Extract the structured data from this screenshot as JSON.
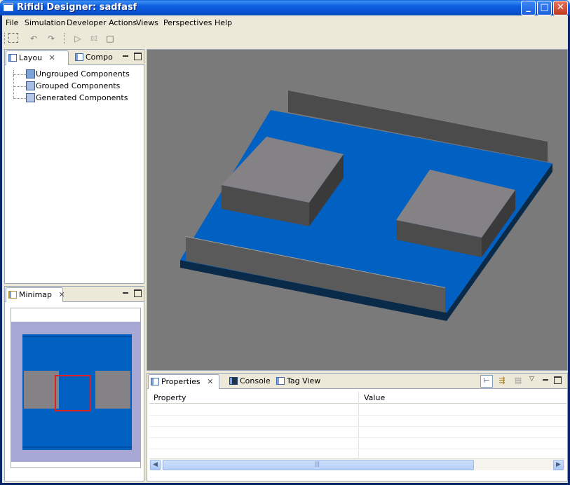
{
  "window": {
    "title": "Rifidi Designer: sadfasf",
    "min_icon": "minimize-icon",
    "max_icon": "maximize-icon",
    "close_icon": "close-icon"
  },
  "menu": [
    "File",
    "Simulation",
    "Developer Actions",
    "Views",
    "Perspectives",
    "Help"
  ],
  "toolbar": {
    "icons": [
      "grid-icon",
      "rotate-left-icon",
      "rotate-right-icon",
      "play-icon",
      "pause-icon",
      "stop-icon"
    ],
    "play_glyph": "▷",
    "pause_glyph": "▯▯",
    "stop_glyph": "□"
  },
  "layout_panel": {
    "tabs": [
      {
        "label": "Layou",
        "close": "✕"
      },
      {
        "label": "Compo"
      }
    ],
    "tree": [
      "Ungrouped Components",
      "Grouped Components",
      "Generated Components"
    ]
  },
  "minimap_panel": {
    "tab_label": "Minimap",
    "close": "✕"
  },
  "properties_panel": {
    "tabs": [
      {
        "label": "Properties",
        "close": "✕"
      },
      {
        "label": "Console"
      },
      {
        "label": "Tag View"
      }
    ],
    "columns": [
      "Property",
      "Value"
    ]
  },
  "colors": {
    "floor_blue": "#0061c3",
    "floor_dark": "#0a2a4a",
    "box_top": "#858285",
    "box_side": "#4b4b4b",
    "wall_front": "#5a5a5a",
    "background": "#7a7a7a",
    "minimap_bg": "#a7a8d3",
    "minimap_selection": "#e02020"
  }
}
